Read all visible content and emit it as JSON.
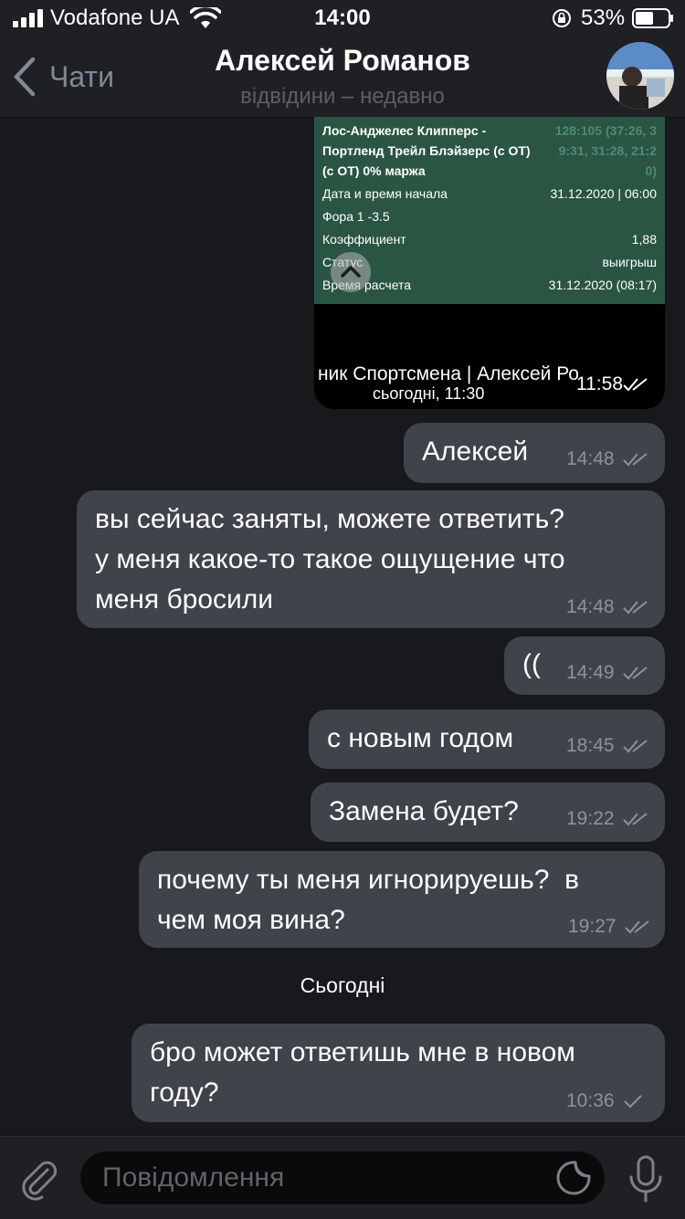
{
  "status_bar": {
    "carrier": "Vodafone UA",
    "time": "14:00",
    "battery": "53%"
  },
  "header": {
    "back_label": "Чати",
    "title": "Алексей Романов",
    "subtitle": "відвідини – недавно"
  },
  "media_message": {
    "card": {
      "match": [
        "Лос-Анджелес Клипперс -",
        "Портленд Трейл Блэйзерс (с ОТ)",
        "(с ОТ) 0% маржа"
      ],
      "score": [
        "128:105 (37:26, 3",
        "9:31, 31:28, 21:2",
        "0)"
      ],
      "rows": [
        {
          "label": "Дата и время начала",
          "value": "31.12.2020 | 06:00"
        },
        {
          "label": "Фора 1 -3.5",
          "value": ""
        },
        {
          "label": "Коэффициент",
          "value": "1,88"
        },
        {
          "label": "Статус",
          "value": "выигрыш"
        },
        {
          "label": "Время расчета",
          "value": "31.12.2020 (08:17)"
        }
      ]
    },
    "caption": "ник Спортсмена | Алексей Ро",
    "date": "сьогодні, 11:30",
    "time": "11:58"
  },
  "messages": [
    {
      "text": "Алексей",
      "time": "14:48"
    },
    {
      "text": "вы сейчас заняты, можете ответить?\nу меня какое-то такое ощущение что\nменя бросили",
      "time": "14:48"
    },
    {
      "text": "((",
      "time": "14:49"
    },
    {
      "text": "с новым годом",
      "time": "18:45"
    },
    {
      "text": "Замена будет?",
      "time": "19:22"
    },
    {
      "text": "почему ты меня игнорируешь?  в\nчем моя вина?",
      "time": "19:27"
    },
    {
      "text": "бро может ответишь мне в новом\nгоду?",
      "time": "10:36"
    }
  ],
  "date_separator": "Сьогодні",
  "input": {
    "placeholder": "Повідомлення"
  },
  "colors": {
    "background": "#17191c",
    "bubble": "#3f434a",
    "card_green": "#2a5543",
    "accent_back": "#7f8a97"
  },
  "icons": [
    "signal-icon",
    "wifi-icon",
    "orientation-lock-icon",
    "battery-icon",
    "back-chevron-icon",
    "collapse-icon",
    "double-check-icon",
    "single-check-icon",
    "attach-icon",
    "sticker-icon",
    "microphone-icon"
  ]
}
